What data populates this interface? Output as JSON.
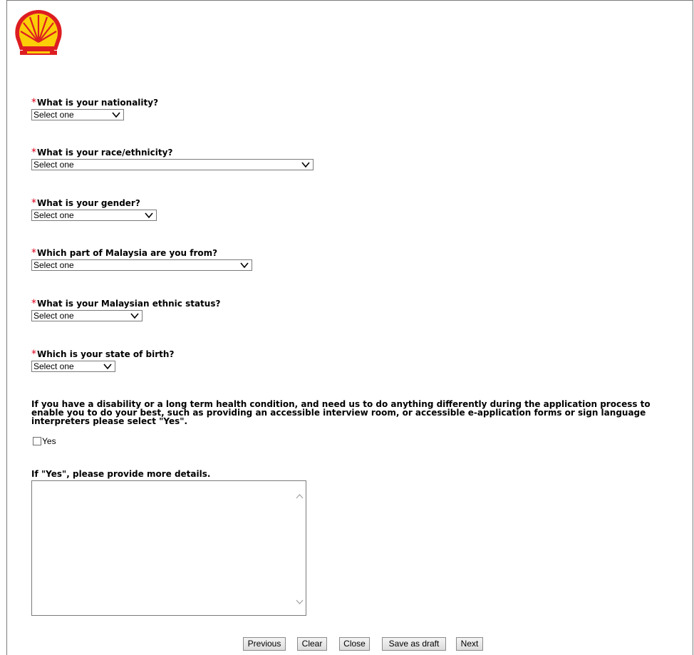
{
  "brand": {
    "logo_icon": "shell-pecten-logo",
    "red": "#DD1D21",
    "yellow": "#FBCE07"
  },
  "required_marker": "*",
  "questions": [
    {
      "label": "What is your nationality?",
      "selected": "Select one"
    },
    {
      "label": "What is your race/ethnicity?",
      "selected": "Select one"
    },
    {
      "label": "What is your gender?",
      "selected": "Select one"
    },
    {
      "label": "Which part of Malaysia are you from?",
      "selected": "Select one"
    },
    {
      "label": "What is your Malaysian ethnic status?",
      "selected": "Select one"
    },
    {
      "label": "Which is your state of birth?",
      "selected": "Select one"
    }
  ],
  "disability": {
    "line1": "If you have a disability or a long term health condition, and need us to do anything differently during the application process to",
    "line2": "enable you to do your best, such as providing an accessible interview room, or accessible e-application forms or sign language",
    "line3": "interpreters please select \"Yes\".",
    "checkbox_label": "Yes",
    "checked": false
  },
  "details": {
    "label": "If \"Yes\", please provide more details.",
    "value": ""
  },
  "footer_buttons": {
    "previous": "Previous",
    "clear": "Clear",
    "close": "Close",
    "save_draft": "Save as draft",
    "next": "Next"
  }
}
